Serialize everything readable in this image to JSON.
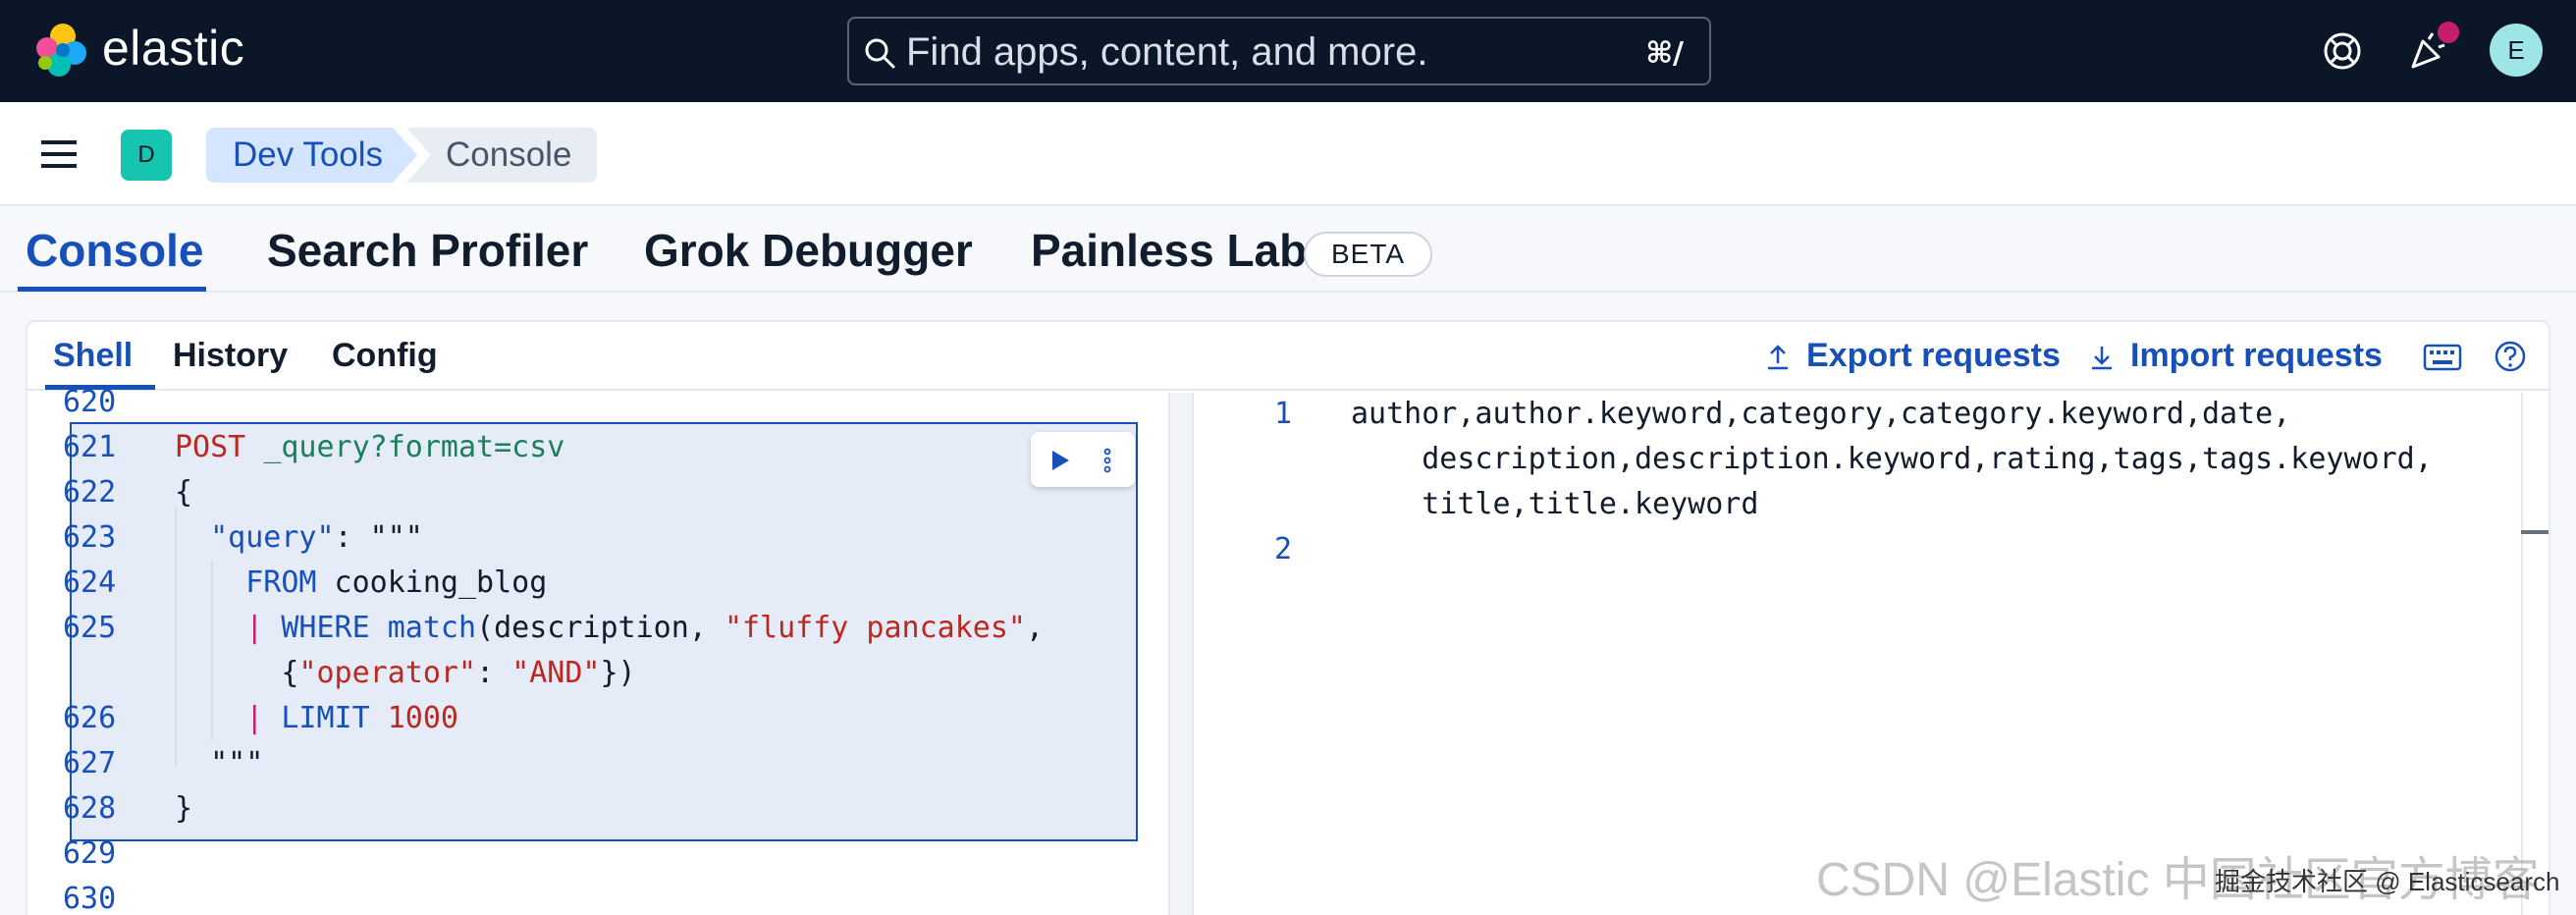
{
  "header": {
    "brand": "elastic",
    "search_placeholder": "Find apps, content, and more.",
    "search_shortcut": "⌘/",
    "avatar_initial": "E"
  },
  "breadcrumb": {
    "space_initial": "D",
    "items": [
      "Dev Tools",
      "Console"
    ]
  },
  "main_tabs": {
    "items": [
      "Console",
      "Search Profiler",
      "Grok Debugger",
      "Painless Lab"
    ],
    "active": "Console",
    "beta_label": "BETA"
  },
  "console": {
    "subtabs": [
      "Shell",
      "History",
      "Config"
    ],
    "active_subtab": "Shell",
    "export_label": "Export requests",
    "import_label": "Import requests",
    "editor": {
      "line_numbers": [
        "620",
        "621",
        "622",
        "623",
        "624",
        "625",
        "",
        "626",
        "627",
        "628",
        "629",
        "630"
      ],
      "lines": [
        "",
        "POST _query?format=csv",
        "{",
        "  \"query\": \"\"\"",
        "    FROM cooking_blog",
        "    | WHERE match(description, \"fluffy pancakes\",",
        "      {\"operator\": \"AND\"})",
        "    | LIMIT 1000",
        "  \"\"\"",
        "}",
        "",
        ""
      ]
    },
    "output": {
      "line_numbers": [
        "1",
        "",
        "",
        "2"
      ],
      "lines": [
        "author,author.keyword,category,category.keyword,date,",
        "    description,description.keyword,rating,tags,tags.keyword,",
        "    title,title.keyword",
        ""
      ]
    }
  },
  "watermark": {
    "text": "CSDN @Elastic 中国社区官方博客",
    "overlay": "掘金技术社区 @ Elasticsearch"
  },
  "colors": {
    "header_bg": "#0b1628",
    "accent": "#1750ba",
    "selection": "#e6ebf8"
  }
}
